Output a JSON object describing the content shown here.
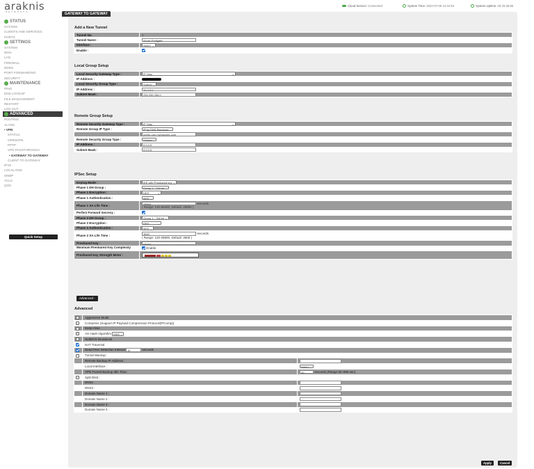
{
  "brand": {
    "logo": "araknis",
    "tagline": "NETWORKS"
  },
  "top_status": {
    "cloud_label": "Cloud Service:",
    "cloud_value": "Connected",
    "time_label": "System Time:",
    "time_value": "2022-07-05 12:44:54",
    "uptime_label": "System Uptime:",
    "uptime_value": "0d 20:46:55"
  },
  "sidebar": {
    "status": "STATUS",
    "status_items": [
      "SYSTEM",
      "CLIENTS AND SERVICES",
      "PORTS"
    ],
    "settings": "SETTINGS",
    "settings_items": [
      "SYSTEM",
      "WAN",
      "LAN",
      "FIREWALL",
      "DDNS",
      "PORT FORWARDING",
      "SECURITY"
    ],
    "maintenance": "MAINTENANCE",
    "maintenance_items": [
      "PING",
      "DNS LOOKUP",
      "FILE MANAGEMENT",
      "RESTART",
      "LOG OUT"
    ],
    "advanced": "ADVANCED",
    "adv_items": [
      "ROUTING",
      "VLANS"
    ],
    "vpn": "• VPN",
    "vpn_items": [
      "STATUS",
      "OPENVPN",
      "PPTP",
      "VPN PASSTHROUGH"
    ],
    "gw": "• GATEWAY TO GATEWAY",
    "after_items": [
      "CLIENT TO GATEWAY"
    ],
    "rest_items": [
      "IPV6",
      "LOCAL DNS",
      "SNMP",
      "ACLS",
      "QOS"
    ],
    "quick_setup": "Quick Setup"
  },
  "page_title": "GATEWAY TO GATEWAY",
  "add_tunnel": {
    "heading": "Add a New Tunnel",
    "tunnel_no_label": "Tunnel No.",
    "tunnel_no": "1",
    "tunnel_name_label": "Tunnel Name :",
    "tunnel_name": "Azure-Fortigate",
    "interface_label": "Interface :",
    "interface": "WAN1",
    "enable_label": "Enable :"
  },
  "local_group": {
    "heading": "Local Group Setup",
    "gw_type_label": "Local Security Gateway Type :",
    "gw_type": "IP Only",
    "ip_label": "IP Address :",
    "group_type_label": "Local Security Group Type :",
    "group_type": "Subnet",
    "ip2_label": "IP Address :",
    "ip2": "10.0.0.0",
    "mask_label": "Subnet Mask :",
    "mask": "255.255.255.0"
  },
  "remote_group": {
    "heading": "Remote Group Setup",
    "gw_type_label": "Remote Security Gateway Type :",
    "gw_type": "IP Only",
    "ip_type_label": "Remote Group IP Type :",
    "ip_type": "IP by DNS Resolved",
    "host": "public-vpn.myeasytek.com",
    "group_type_label": "Remote Security Group Type :",
    "group_type": "Subnet",
    "ip_label": "IP Address :",
    "ip": "0.0.0.0",
    "mask_label": "Subnet Mask :",
    "mask": "0.0.0.0"
  },
  "ipsec": {
    "heading": "IPSec Setup",
    "keying_label": "Keying Mode :",
    "keying": "IKE with Preshared key",
    "p1_dh_label": "Phase 1 DH Group :",
    "p1_dh": "Group 1 - 768 bit",
    "p1_enc_label": "Phase 1 Encryption :",
    "p1_enc": "DES",
    "p1_auth_label": "Phase 1 Authentication :",
    "p1_auth": "MD5",
    "p1_sa_label": "Phase 1 SA Life Time :",
    "p1_sa": "28800",
    "p1_sa_unit": "seconds",
    "p1_sa_range": "( Range: 120-86400, Default: 28800 )",
    "pfs_label": "Perfect Forward Secrecy :",
    "p2_dh_label": "Phase 2 DH Group :",
    "p2_dh": "Group 1 - 768 bit",
    "p2_enc_label": "Phase 2 Encryption :",
    "p2_enc": "DES",
    "p2_auth_label": "Phase 2 Authentication :",
    "p2_auth": "MD5",
    "p2_sa_label": "Phase 2 SA Life Time :",
    "p2_sa": "3600",
    "p2_sa_unit": "seconds",
    "p2_sa_range": "( Range: 120-28800, Default: 3600 )",
    "psk_label": "Preshared Key :",
    "psk": "••••••••",
    "complexity_label": "Minimum Preshared Key Complexity",
    "complexity_enable": "Enable",
    "meter_label": "Preshared Key Strength Meter :",
    "advanced_button": "Advanced -"
  },
  "advanced": {
    "heading": "Advanced",
    "aggressive": "Aggressive Mode",
    "compress": "Compress (Support IP Payload Compression Protocol(IPComp))",
    "keepalive": "Keep-Alive",
    "ah_hash": "AH Hash Algorithm",
    "ah_hash_value": "MD5",
    "netbios": "NetBIOS Broadcast",
    "nat": "NAT Traversal",
    "dpd": "Dead Peer Detection Interval",
    "dpd_value": "10",
    "dpd_unit": "seconds",
    "backup": "Tunnel Backup :",
    "backup_ip": "Remote Backup IP Address :",
    "local_if": "Local Interface :",
    "local_if_value": "WAN1",
    "idle": "VPN Tunnel Backup Idle Time :",
    "idle_value": "30",
    "idle_unit": "seconds (Range:30~999 sec)",
    "split_dns": "Split DNS :",
    "dns1": "DNS1 :",
    "dns2": "DNS2 :",
    "dn1": "Domain Name 1 :",
    "dn2": "Domain Name 2 :",
    "dn3": "Domain Name 3 :",
    "dn4": "Domain Name 4 :"
  },
  "buttons": {
    "apply": "Apply",
    "cancel": "Cancel"
  },
  "colors": {
    "accent_green": "#59ad4e",
    "checkbox_blue": "#1e6fd4",
    "row_gray": "#9b9b9b"
  }
}
